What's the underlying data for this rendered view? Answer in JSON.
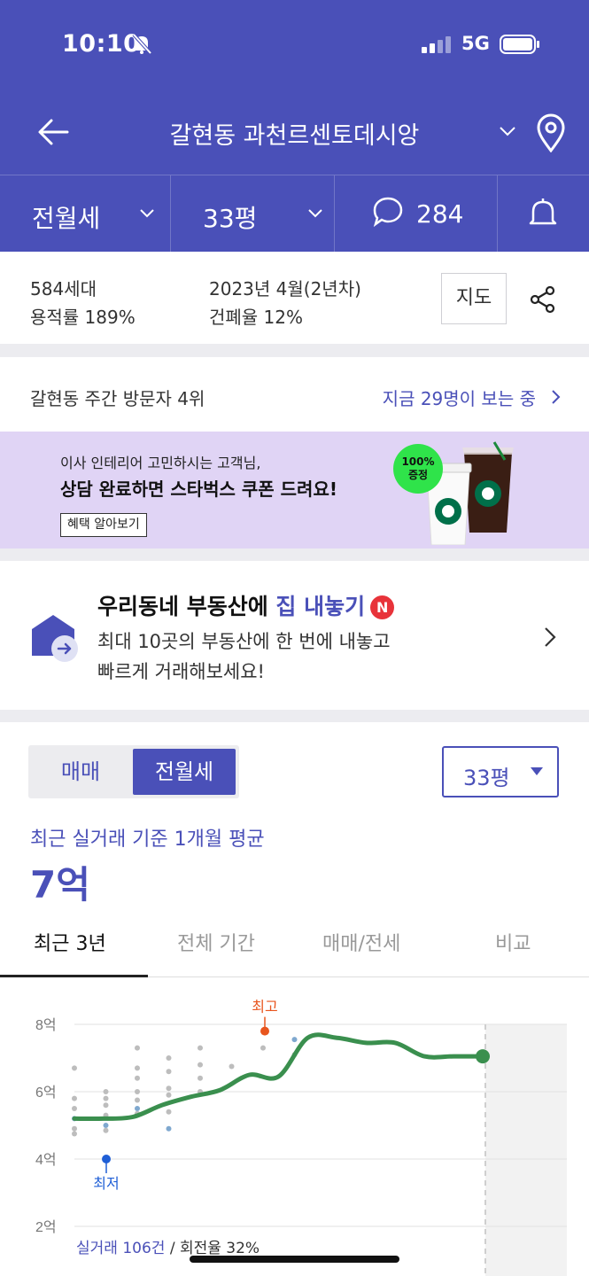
{
  "status_bar": {
    "time": "10:10",
    "network": "5G"
  },
  "header": {
    "title": "갈현동 과천르센토데시앙"
  },
  "filters": {
    "deal_type": "전월세",
    "size": "33평",
    "comment_count": "284"
  },
  "info": {
    "households": "584세대",
    "floor_area_ratio": "용적률 189%",
    "built": "2023년 4월(2년차)",
    "coverage_ratio": "건폐율 12%",
    "map_button": "지도"
  },
  "visitors": {
    "rank": "갈현동 주간 방문자 4위",
    "watching": "지금 29명이 보는 중"
  },
  "banner": {
    "line1": "이사 인테리어 고민하시는 고객님,",
    "line2": "상담 완료하면 스타벅스 쿠폰 드려요!",
    "button": "혜택 알아보기",
    "badge_line1": "100%",
    "badge_line2": "증정"
  },
  "promo": {
    "title_prefix": "우리동네 부동산에 ",
    "title_highlight": "집 내놓기",
    "badge": "N",
    "desc_line1": "최대 10곳의 부동산에 한 번에 내놓고",
    "desc_line2": "빠르게 거래해보세요!"
  },
  "price": {
    "segment": [
      "매매",
      "전월세"
    ],
    "size_select": "33평",
    "avg_label": "최근 실거래 기준 1개월 평균",
    "avg_value": "7억",
    "period_tabs": [
      "최근 3년",
      "전체 기간",
      "매매/전세",
      "비교"
    ]
  },
  "chart_data": {
    "type": "line",
    "yticks": [
      "8억",
      "6억",
      "4억",
      "2억"
    ],
    "y_values": [
      8,
      6,
      4,
      2
    ],
    "ylim": [
      2,
      8
    ],
    "grid": true,
    "high_label": "최고",
    "low_label": "최저",
    "high_point": 7.8,
    "low_point": 4.0,
    "trend": [
      5.2,
      5.2,
      5.25,
      5.6,
      5.85,
      6.05,
      6.5,
      6.45,
      7.6,
      7.6,
      7.45,
      7.45,
      7.05,
      7.05,
      7.05
    ],
    "last_value": 7.05,
    "scatter": [
      {
        "x": 0,
        "y": 6.7
      },
      {
        "x": 0,
        "y": 5.8
      },
      {
        "x": 0,
        "y": 5.5
      },
      {
        "x": 0,
        "y": 5.2
      },
      {
        "x": 0,
        "y": 4.9
      },
      {
        "x": 0,
        "y": 4.75
      },
      {
        "x": 1,
        "y": 6.0
      },
      {
        "x": 1,
        "y": 5.8
      },
      {
        "x": 1,
        "y": 5.6
      },
      {
        "x": 1,
        "y": 5.3
      },
      {
        "x": 1,
        "y": 5.0
      },
      {
        "x": 1,
        "y": 4.85
      },
      {
        "x": 2,
        "y": 7.3
      },
      {
        "x": 2,
        "y": 6.7
      },
      {
        "x": 2,
        "y": 6.4
      },
      {
        "x": 2,
        "y": 6.0
      },
      {
        "x": 2,
        "y": 5.75
      },
      {
        "x": 2,
        "y": 5.5
      },
      {
        "x": 2,
        "y": 5.35
      },
      {
        "x": 3,
        "y": 7.0
      },
      {
        "x": 3,
        "y": 6.6
      },
      {
        "x": 3,
        "y": 6.1
      },
      {
        "x": 3,
        "y": 5.9
      },
      {
        "x": 3,
        "y": 5.4
      },
      {
        "x": 3,
        "y": 4.9
      },
      {
        "x": 4,
        "y": 7.3
      },
      {
        "x": 4,
        "y": 6.8
      },
      {
        "x": 4,
        "y": 6.4
      },
      {
        "x": 4,
        "y": 6.0
      },
      {
        "x": 5,
        "y": 6.75
      },
      {
        "x": 6,
        "y": 7.3
      },
      {
        "x": 7,
        "y": 7.55
      },
      {
        "x": 7,
        "y": 7.1
      }
    ],
    "summary": "실거래 106건",
    "summary_rest": " / 회전율 32%",
    "colors": {
      "line": "#3a8f4e",
      "high": "#e8551e",
      "low": "#1f5fd6",
      "point": "#bdbdbd",
      "point_blue": "#7fa8cf"
    }
  },
  "colors": {
    "accent": "#4a50b8",
    "banner_bg": "#e0d4f5",
    "badge_red": "#e8333a"
  }
}
